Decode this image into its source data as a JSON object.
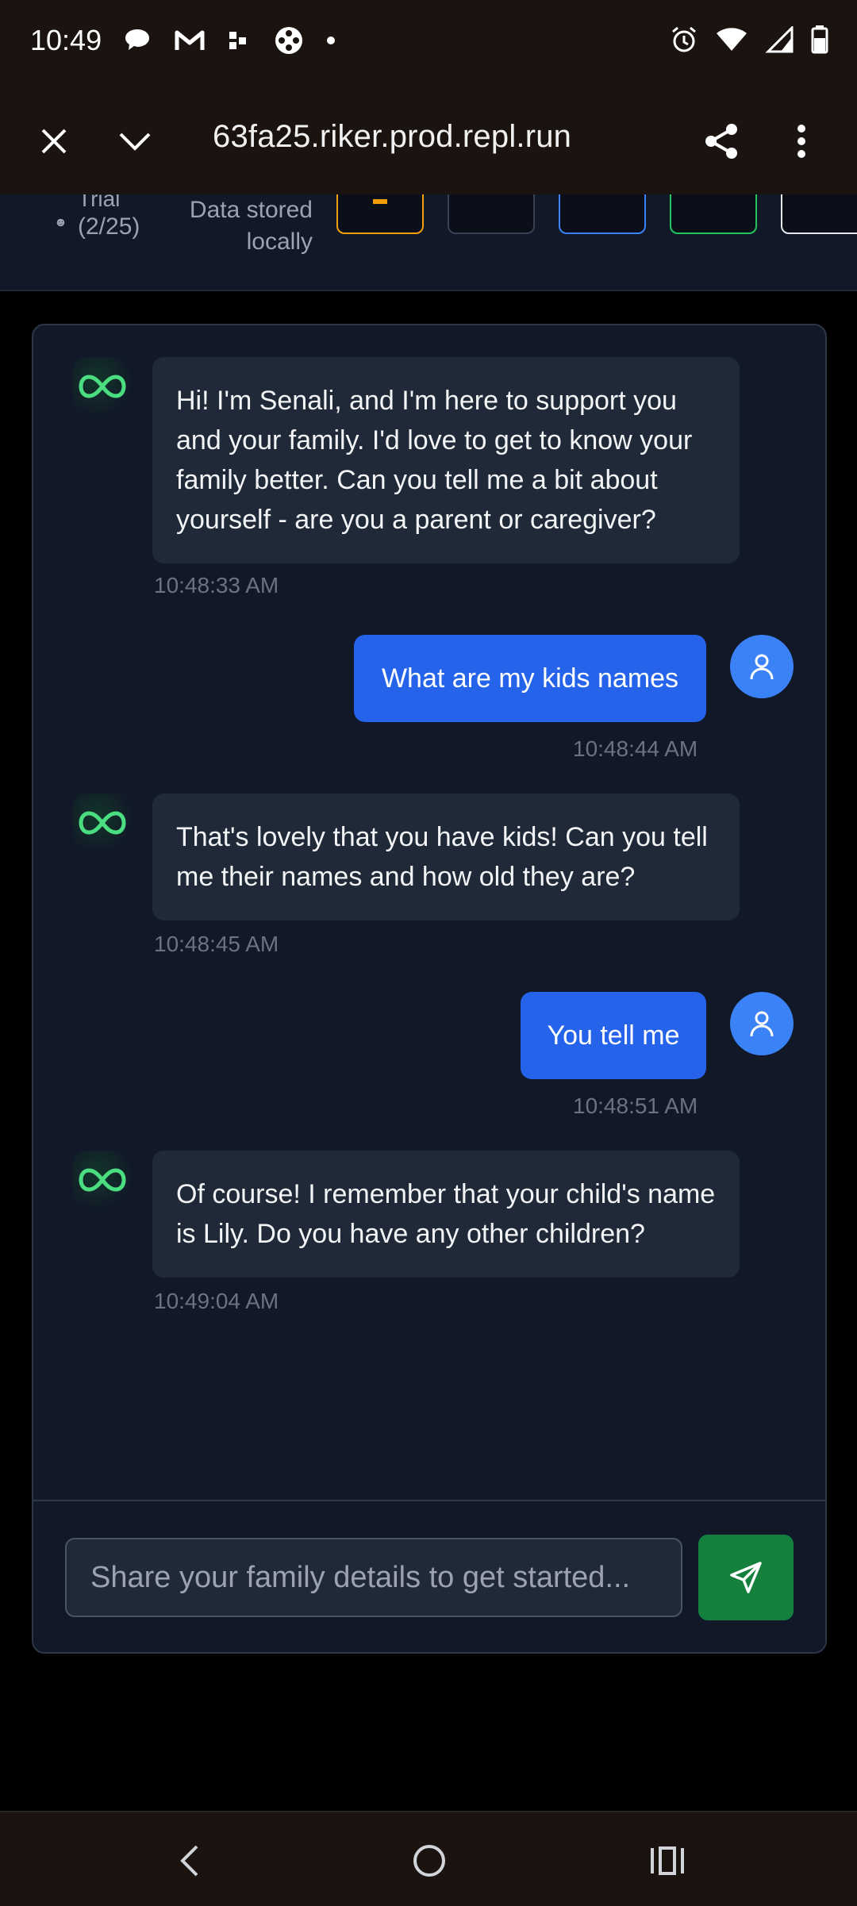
{
  "status_bar": {
    "time": "10:49",
    "left_icons": [
      "chat-bubble-icon",
      "gmail-icon",
      "app-icon",
      "game-icon",
      "dot-icon"
    ],
    "right_icons": [
      "alarm-icon",
      "wifi-icon",
      "signal-icon",
      "battery-icon"
    ]
  },
  "browser": {
    "url": "63fa25.riker.prod.repl.run",
    "close_icon": "close-icon",
    "tabs_icon": "chevron-down-icon",
    "share_icon": "share-icon",
    "menu_icon": "more-vert-icon"
  },
  "app_header": {
    "trial_label": "Trial",
    "trial_count": "(2/25)",
    "storage_note": "Data stored locally",
    "button_colors": [
      "#f59e0b",
      "#374151",
      "#3b82f6",
      "#22c55e",
      "#e5e7eb"
    ]
  },
  "chat": {
    "messages": [
      {
        "sender": "bot",
        "text": "Hi! I'm Senali, and I'm here to support you and your family. I'd love to get to know your family better. Can you tell me a bit about yourself - are you a parent or caregiver?",
        "time": "10:48:33 AM"
      },
      {
        "sender": "user",
        "text": "What are my kids names",
        "time": "10:48:44 AM"
      },
      {
        "sender": "bot",
        "text": "That's lovely that you have kids! Can you tell me their names and how old they are?",
        "time": "10:48:45 AM"
      },
      {
        "sender": "user",
        "text": "You tell me",
        "time": "10:48:51 AM"
      },
      {
        "sender": "bot",
        "text": "Of course! I remember that your child's name is Lily. Do you have any other children?",
        "time": "10:49:04 AM"
      }
    ]
  },
  "composer": {
    "placeholder": "Share your family details to get started...",
    "send_icon": "send-icon"
  },
  "colors": {
    "bot_accent": "#4ade80",
    "user_bubble": "#2563eb",
    "send_button": "#15803d"
  },
  "nav_bar": {
    "icons": [
      "back-icon",
      "home-icon",
      "recents-icon"
    ]
  }
}
